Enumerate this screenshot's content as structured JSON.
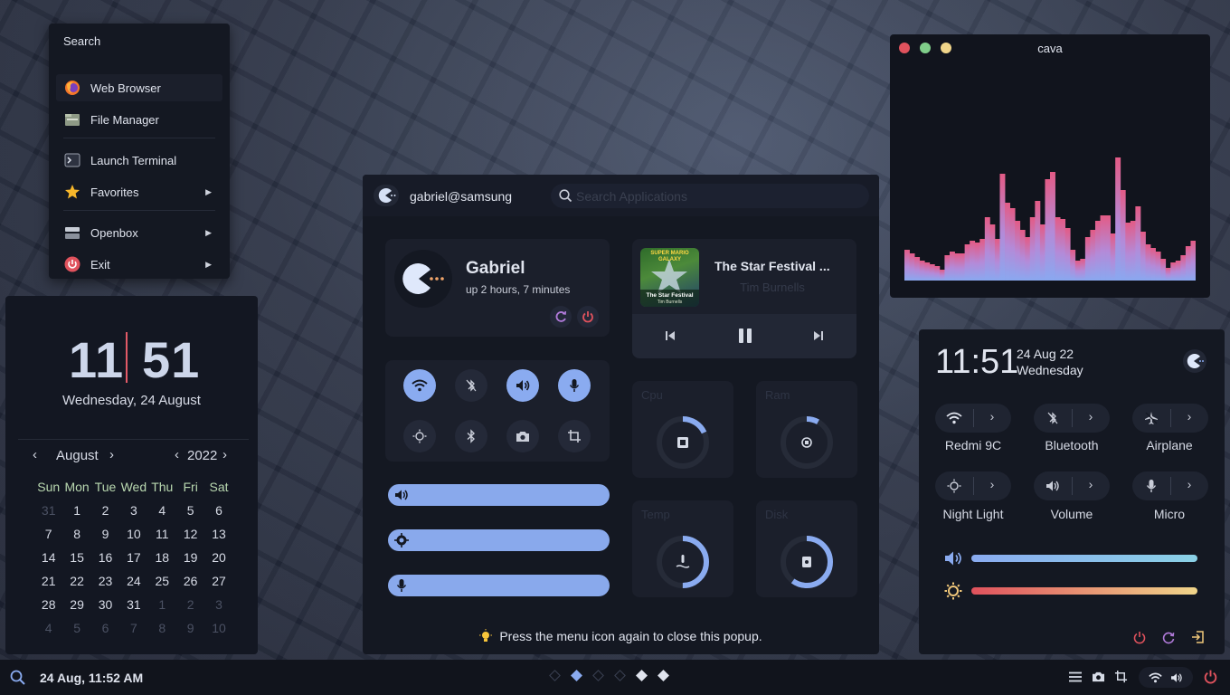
{
  "menu": {
    "title": "Search",
    "items": [
      {
        "label": "Web Browser"
      },
      {
        "label": "File Manager"
      },
      {
        "label": "Launch Terminal"
      },
      {
        "label": "Favorites"
      },
      {
        "label": "Openbox"
      },
      {
        "label": "Exit"
      }
    ]
  },
  "clock_widget": {
    "hour": "11",
    "minute": "51",
    "date": "Wednesday, 24 August",
    "month": "August",
    "year": "2022",
    "weekdays": [
      "Sun",
      "Mon",
      "Tue",
      "Wed",
      "Thu",
      "Fri",
      "Sat"
    ],
    "weeks": [
      [
        "31",
        "1",
        "2",
        "3",
        "4",
        "5",
        "6"
      ],
      [
        "7",
        "8",
        "9",
        "10",
        "11",
        "12",
        "13"
      ],
      [
        "14",
        "15",
        "16",
        "17",
        "18",
        "19",
        "20"
      ],
      [
        "21",
        "22",
        "23",
        "24",
        "25",
        "26",
        "27"
      ],
      [
        "28",
        "29",
        "30",
        "31",
        "1",
        "2",
        "3"
      ],
      [
        "4",
        "5",
        "6",
        "7",
        "8",
        "9",
        "10"
      ]
    ]
  },
  "popup": {
    "user": "gabriel@samsung",
    "search_placeholder": "Search Applications",
    "profile_name": "Gabriel",
    "uptime": "up 2 hours, 7 minutes",
    "music": {
      "title": "The Star Festival ...",
      "artist": "Tim Burnells",
      "art_top": "SUPER MARIO GALAXY",
      "art_bottom": "The Star Festival",
      "art_sub": "Tim Burnells"
    },
    "stats": {
      "cpu": "Cpu",
      "ram": "Ram",
      "temp": "Temp",
      "disk": "Disk"
    },
    "stat_levels": {
      "cpu": 0.18,
      "ram": 0.08,
      "temp": 0.5,
      "disk": 0.6
    },
    "hint": "Press the menu icon again to close this popup."
  },
  "cava": {
    "title": "cava"
  },
  "control_center": {
    "time": "11:51",
    "date": "24 Aug 22",
    "day": "Wednesday",
    "toggles": [
      {
        "label": "Redmi 9C"
      },
      {
        "label": "Bluetooth"
      },
      {
        "label": "Airplane"
      },
      {
        "label": "Night Light"
      },
      {
        "label": "Volume"
      },
      {
        "label": "Micro"
      }
    ]
  },
  "taskbar": {
    "datetime": "24 Aug, 11:52 AM"
  },
  "colors": {
    "accent": "#8aabf0",
    "background": "#141822",
    "danger": "#e0525d",
    "card": "#1b1f2b"
  }
}
